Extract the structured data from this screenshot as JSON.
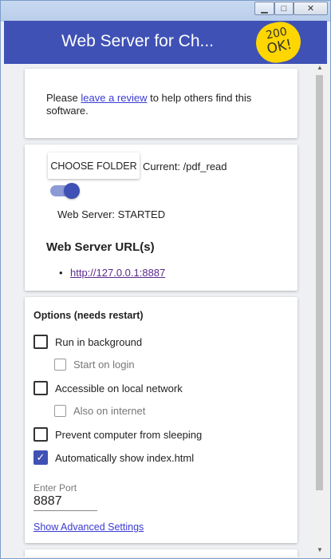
{
  "window": {
    "controls": {
      "minimize": "▁",
      "maximize": "□",
      "close": "✕"
    }
  },
  "app_bar": {
    "title": "Web Server for Ch...",
    "badge_line1": "200",
    "badge_line2": "OK!"
  },
  "review_card": {
    "text_before": "Please ",
    "link": "leave a review",
    "text_after": " to help others find this software."
  },
  "server_card": {
    "choose_folder_button": "CHOOSE FOLDER",
    "current_folder": "Current: /pdf_read",
    "toggle_on": true,
    "status": "Web Server: STARTED",
    "urls_heading": "Web Server URL(s)",
    "urls": [
      "http://127.0.0.1:8887"
    ]
  },
  "options_card": {
    "heading": "Options (needs restart)",
    "options": [
      {
        "label": "Run in background",
        "checked": false
      },
      {
        "label": "Start on login",
        "checked": false
      },
      {
        "label": "Accessible on local network",
        "checked": false
      },
      {
        "label": "Also on internet",
        "checked": false
      },
      {
        "label": "Prevent computer from sleeping",
        "checked": false
      },
      {
        "label": "Automatically show index.html",
        "checked": true
      }
    ],
    "port_label": "Enter Port",
    "port_value": "8887",
    "advanced_link": "Show Advanced Settings"
  },
  "colors": {
    "accent": "#3f51b5",
    "badge": "#ffd600",
    "link": "#3b3bd4"
  }
}
